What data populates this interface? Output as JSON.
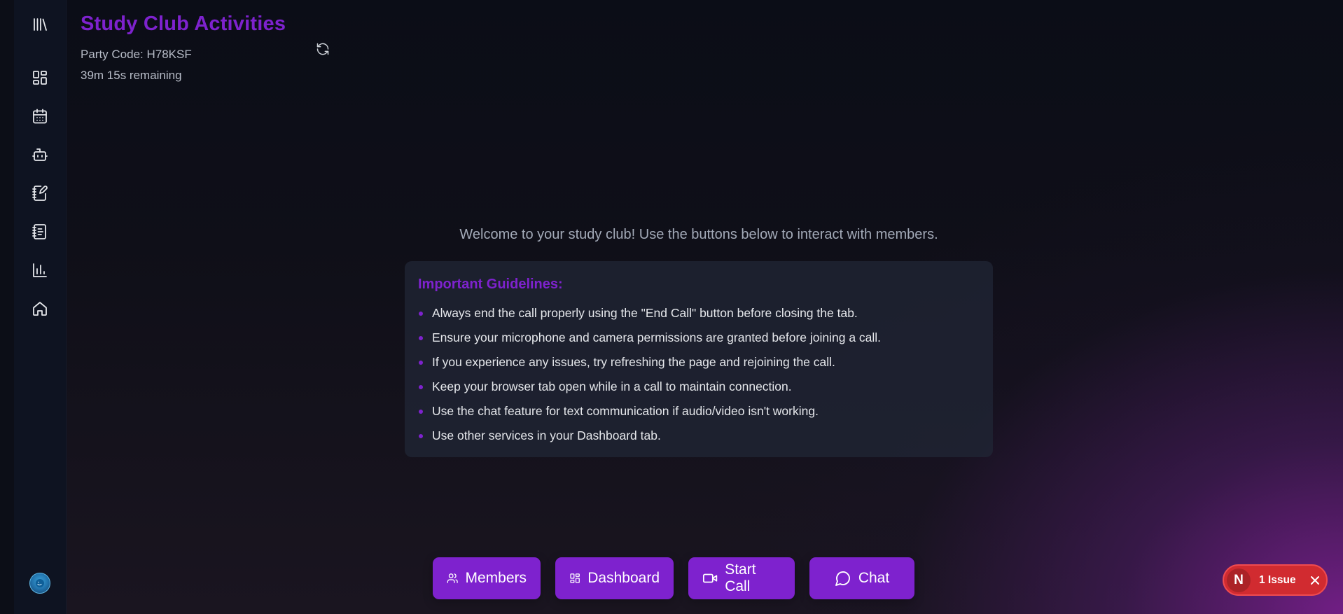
{
  "header": {
    "title": "Study Club Activities",
    "party_code": "Party Code: H78KSF",
    "time_remaining": "39m 15s remaining"
  },
  "sidebar": {
    "items": [
      {
        "icon": "library-icon"
      },
      {
        "icon": "dashboard-icon"
      },
      {
        "icon": "calendar-icon"
      },
      {
        "icon": "bot-icon"
      },
      {
        "icon": "notebook-pen-icon"
      },
      {
        "icon": "notebook-text-icon"
      },
      {
        "icon": "bar-chart-icon"
      },
      {
        "icon": "home-icon"
      }
    ],
    "avatar_icon": "user-avatar"
  },
  "main": {
    "welcome": "Welcome to your study club! Use the buttons below to interact with members.",
    "guidelines_title": "Important Guidelines:",
    "guidelines": [
      "Always end the call properly using the \"End Call\" button before closing the tab.",
      "Ensure your microphone and camera permissions are granted before joining a call.",
      "If you experience any issues, try refreshing the page and rejoining the call.",
      "Keep your browser tab open while in a call to maintain connection.",
      "Use the chat feature for text communication if audio/video isn't working.",
      "Use other services in your Dashboard tab."
    ]
  },
  "actions": {
    "members": "Members",
    "dashboard": "Dashboard",
    "start_call": "Start Call",
    "chat": "Chat"
  },
  "dev_overlay": {
    "logo": "N",
    "issues": "1 Issue"
  },
  "colors": {
    "accent": "#7e22ce",
    "sidebar_bg": "#0e1321",
    "issue_red": "#d12b30"
  }
}
